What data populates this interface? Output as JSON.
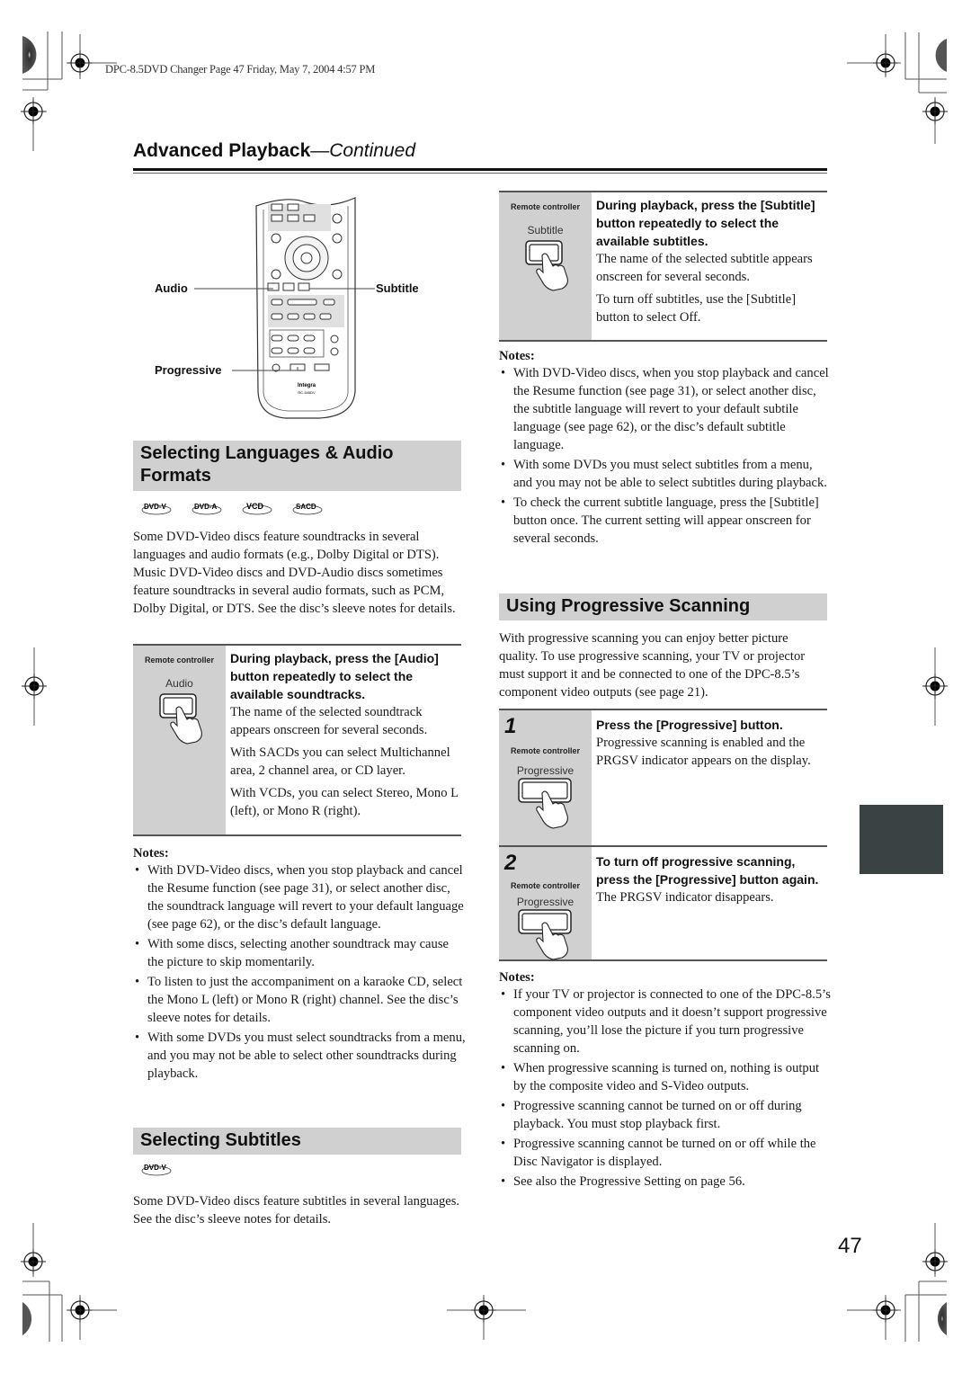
{
  "doc_header": "DPC-8.5DVD Changer  Page 47  Friday, May 7, 2004  4:57 PM",
  "page_title": {
    "main": "Advanced Playback",
    "suffix": "—Continued"
  },
  "remote_diagram": {
    "callouts": {
      "audio": "Audio",
      "subtitle": "Subtitle",
      "progressive": "Progressive"
    },
    "brand": "Integra",
    "model": "RC-545DV"
  },
  "languages_section": {
    "title": "Selecting Languages & Audio Formats",
    "disc_logos": [
      "DVD-V",
      "DVD-A",
      "VCD",
      "SACD"
    ],
    "intro": "Some DVD-Video discs feature soundtracks in several languages and audio formats (e.g., Dolby Digital or DTS). Music DVD-Video discs and DVD-Audio discs sometimes feature soundtracks in several audio formats, such as PCM, Dolby Digital, or DTS. See the disc’s sleeve notes for details.",
    "step": {
      "rc_label": "Remote controller",
      "button_name": "Audio",
      "instruction": "During playback, press the [Audio] button repeatedly to select the available soundtracks.",
      "paragraphs": [
        "The name of the selected soundtrack appears onscreen for several seconds.",
        "With SACDs you can select Multichannel area, 2 channel area, or CD layer.",
        "With VCDs, you can select Stereo, Mono L (left), or Mono R (right)."
      ]
    },
    "notes_title": "Notes:",
    "notes": [
      "With DVD-Video discs, when you stop playback and cancel the Resume function (see page 31), or select another disc, the soundtrack language will revert to your default language (see page 62), or the disc’s default language.",
      "With some discs, selecting another soundtrack may cause the picture to skip momentarily.",
      "To listen to just the accompaniment on a karaoke CD, select the Mono L (left) or Mono R (right) channel. See the disc’s sleeve notes for details.",
      "With some DVDs you must select soundtracks from a menu, and you may not be able to select other soundtracks during playback."
    ]
  },
  "subtitles_section": {
    "title": "Selecting Subtitles",
    "disc_logos": [
      "DVD-V"
    ],
    "intro": "Some DVD-Video discs feature subtitles in several languages. See the disc’s sleeve notes for details.",
    "step": {
      "rc_label": "Remote controller",
      "button_name": "Subtitle",
      "instruction": "During playback, press the [Subtitle] button repeatedly to select the available subtitles.",
      "paragraphs": [
        "The name of the selected subtitle appears onscreen for several seconds.",
        "To turn off subtitles, use the [Subtitle] button to select Off."
      ]
    },
    "notes_title": "Notes:",
    "notes": [
      "With DVD-Video discs, when you stop playback and cancel the Resume function (see page 31), or select another disc, the subtitle language will revert to your default subtile language (see page 62), or the disc’s default subtitle language.",
      "With some DVDs you must select subtitles from a menu, and you may not be able to select subtitles during playback.",
      "To check the current subtitle language, press the [Subtitle] button once. The current setting will appear onscreen for several seconds."
    ]
  },
  "progressive_section": {
    "title": "Using Progressive Scanning",
    "intro": "With progressive scanning you can enjoy better picture quality. To use progressive scanning, your TV or projector must support it and be connected to one of the DPC-8.5’s component video outputs (see page 21).",
    "steps": [
      {
        "number": "1",
        "rc_label": "Remote controller",
        "button_name": "Progressive",
        "instruction": "Press the [Progressive] button.",
        "text": "Progressive scanning is enabled and the PRGSV indicator appears on the display."
      },
      {
        "number": "2",
        "rc_label": "Remote controller",
        "button_name": "Progressive",
        "instruction": "To turn off progressive scanning, press the [Progressive] button again.",
        "text": "The PRGSV indicator disappears."
      }
    ],
    "notes_title": "Notes:",
    "notes": [
      "If your TV or projector is connected to one of the DPC-8.5’s component video outputs and it doesn’t support progressive scanning, you’ll lose the picture if you turn progressive scanning on.",
      "When progressive scanning is turned on, nothing is output by the composite video and S-Video outputs.",
      "Progressive scanning cannot be turned on or off during playback. You must stop playback first.",
      "Progressive scanning cannot be turned on or off while the Disc Navigator is displayed.",
      "See also the Progressive Setting on page 56."
    ]
  },
  "page_number": "47",
  "colors": {
    "section_band": "#d0d0d0",
    "thumb_tab": "#3b4244"
  }
}
